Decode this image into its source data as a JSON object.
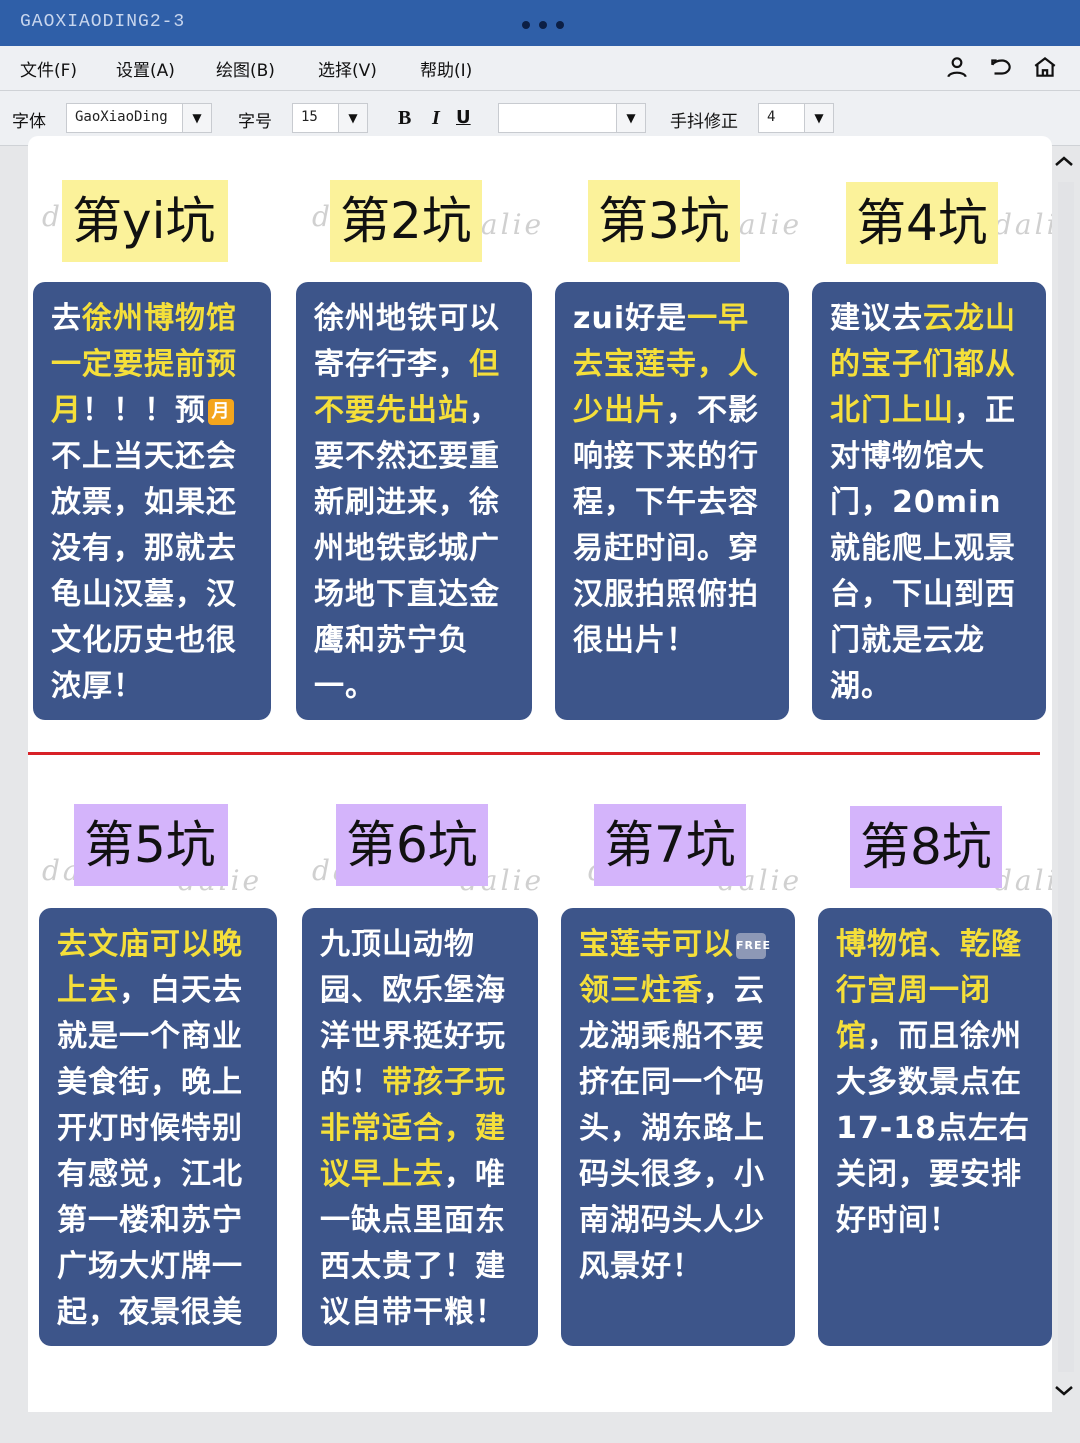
{
  "window": {
    "title": "GAOXIAODING2-3"
  },
  "menu": {
    "items": [
      "文件(F)",
      "设置(A)",
      "绘图(B)",
      "选择(V)",
      "帮助(I)"
    ],
    "icons": [
      "user-icon",
      "undo-icon",
      "home-icon"
    ]
  },
  "toolbar": {
    "font_label": "字体",
    "font_value": "GaoXiaoDing",
    "size_label": "字号",
    "size_value": "15",
    "bold": "B",
    "italic": "I",
    "underline": "U",
    "color_value": "",
    "shake_label": "手抖修正",
    "shake_value": "4"
  },
  "watermark": "dalie",
  "pits": [
    {
      "title": "第yi坑",
      "parts": [
        {
          "t": "去",
          "h": false
        },
        {
          "t": "徐州博物馆一定要提前预月",
          "h": true
        },
        {
          "t": "！！！预",
          "h": false
        },
        {
          "badge": "月"
        },
        {
          "t": "不上当天还会放票，如果还没有，那就去龟山汉墓，汉文化历史也很浓厚！",
          "h": false
        }
      ]
    },
    {
      "title": "第2坑",
      "parts": [
        {
          "t": "徐州地铁可以寄存行李，",
          "h": false
        },
        {
          "t": "但不要先出站",
          "h": true
        },
        {
          "t": "，要不然还要重新刷进来，徐州地铁彭城广场地下直达金鹰和苏宁负一。",
          "h": false
        }
      ]
    },
    {
      "title": "第3坑",
      "parts": [
        {
          "t": "zui好是",
          "h": false
        },
        {
          "t": "一早去宝莲寺，人少出片",
          "h": true
        },
        {
          "t": "，不影响接下来的行程，下午去容易赶时间。穿汉服拍照俯拍很出片！",
          "h": false
        }
      ]
    },
    {
      "title": "第4坑",
      "parts": [
        {
          "t": "建议去",
          "h": false
        },
        {
          "t": "云龙山的宝子们都从北门上山",
          "h": true
        },
        {
          "t": "，正对博物馆大门，20min就能爬上观景台，下山到西门就是云龙湖。",
          "h": false
        }
      ]
    },
    {
      "title": "第5坑",
      "parts": [
        {
          "t": "去文庙可以晚上去",
          "h": true
        },
        {
          "t": "，白天去就是一个商业美食街，晚上开灯时候特别有感觉，江北第一楼和苏宁广场大灯牌一起，夜景很美",
          "h": false
        }
      ]
    },
    {
      "title": "第6坑",
      "parts": [
        {
          "t": "九顶山动物园、欧乐堡海洋世界挺好玩的！",
          "h": false
        },
        {
          "t": "带孩子玩非常适合，建议早上去",
          "h": true
        },
        {
          "t": "，唯一缺点里面东西太贵了！建议自带干粮！",
          "h": false
        }
      ]
    },
    {
      "title": "第7坑",
      "parts": [
        {
          "t": "宝莲寺可以",
          "h": true
        },
        {
          "badge": "FREE"
        },
        {
          "t": "领三炷香",
          "h": true
        },
        {
          "t": "，云龙湖乘船不要挤在同一个码头，湖东路上码头很多，小南湖码头人少风景好！",
          "h": false
        }
      ]
    },
    {
      "title": "第8坑",
      "parts": [
        {
          "t": "博物馆、乾隆行宫周一闭馆",
          "h": true
        },
        {
          "t": "，而且徐州大多数景点在17-18点左右关闭，要安排好时间！",
          "h": false
        }
      ]
    }
  ]
}
